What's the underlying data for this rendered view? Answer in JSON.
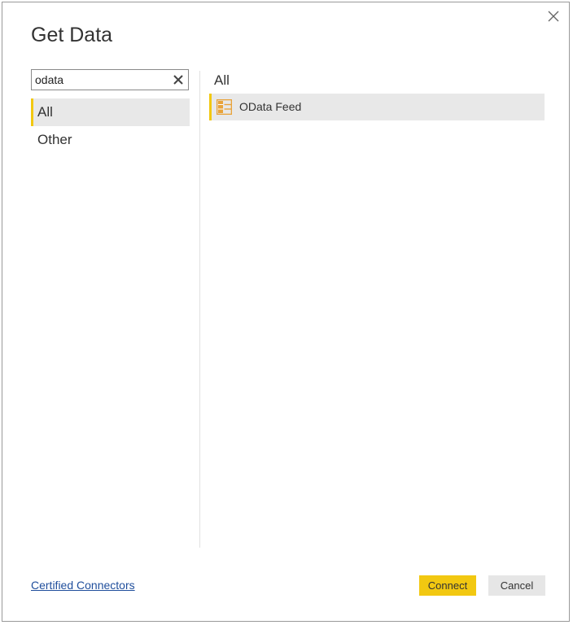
{
  "dialog": {
    "title": "Get Data"
  },
  "search": {
    "value": "odata",
    "placeholder": ""
  },
  "categories": [
    {
      "label": "All",
      "selected": true
    },
    {
      "label": "Other",
      "selected": false
    }
  ],
  "results": {
    "header": "All",
    "items": [
      {
        "label": "OData Feed",
        "icon": "odata-feed-icon",
        "selected": true
      }
    ]
  },
  "footer": {
    "certified_link": "Certified Connectors",
    "connect_label": "Connect",
    "cancel_label": "Cancel"
  },
  "colors": {
    "accent": "#f2c811",
    "selected_bg": "#e8e8e8",
    "icon_orange": "#e8a33a",
    "link": "#1f4e9c"
  }
}
